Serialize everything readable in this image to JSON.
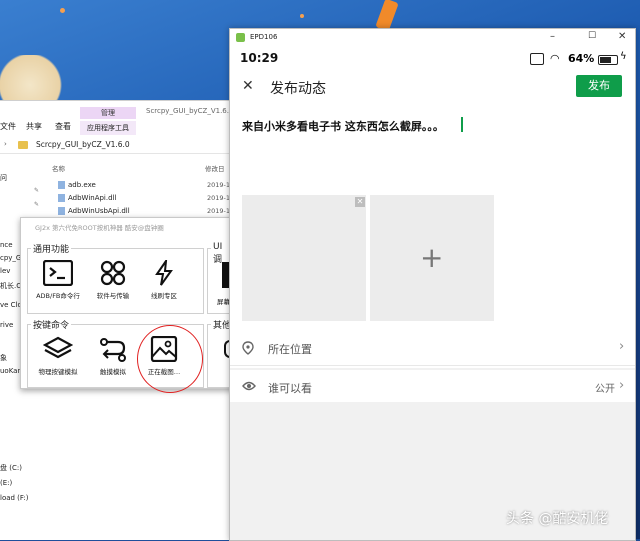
{
  "explorer": {
    "tab_manage": "管理",
    "window_title": "Scrcpy_GUI_byCZ_V1.6.0",
    "tabs": [
      "文件",
      "共享",
      "查看"
    ],
    "tab_app_tools": "应用程序工具",
    "path": "Scrcpy_GUI_byCZ_V1.6.0",
    "col_name": "名称",
    "col_date": "修改日",
    "files": [
      {
        "name": "adb.exe",
        "date": "2019-1"
      },
      {
        "name": "AdbWinApi.dll",
        "date": "2019-1"
      },
      {
        "name": "AdbWinUsbApi.dll",
        "date": "2019-1"
      }
    ],
    "nav": [
      "问",
      "nce",
      "cpy_GU",
      "lev",
      "机长.C",
      "ve Clo",
      "rive",
      "象",
      "uoKan",
      "盘 (C:)",
      "(E:)",
      "load (F:)"
    ]
  },
  "gj": {
    "title": "GJ2x 第六代免ROOT按机神器   酷安@盘钟圈",
    "group1": "通用功能",
    "group2": "按键命令",
    "group3_a": "UI调",
    "group3_b": "其他",
    "buttons1": [
      {
        "label": "ADB/FB命令行",
        "icon": "terminal-icon"
      },
      {
        "label": "软件与传输",
        "icon": "apps-grid-icon"
      },
      {
        "label": "线刷专区",
        "icon": "lightning-icon"
      }
    ],
    "buttons2": [
      {
        "label": "物理按键模拟",
        "icon": "layers-icon"
      },
      {
        "label": "触摸模拟",
        "icon": "swipe-icon"
      },
      {
        "label": "正在截图…",
        "icon": "image-icon"
      }
    ],
    "side_label": "屏幕"
  },
  "phone": {
    "window_name": "EPD106",
    "time": "10:29",
    "battery": "64%",
    "page_title": "发布动态",
    "publish": "发布",
    "post_text": "来自小米多看电子书  这东西怎么截屏。。。",
    "rows": [
      {
        "label": "所在位置",
        "value": "",
        "icon": "location-pin-icon"
      },
      {
        "label": "谁可以看",
        "value": "公开",
        "icon": "eye-icon"
      }
    ]
  },
  "watermark": "头条 @酷安机佬",
  "colors": {
    "publish_green": "#0f9d4a",
    "annotation_red": "#e02020"
  }
}
